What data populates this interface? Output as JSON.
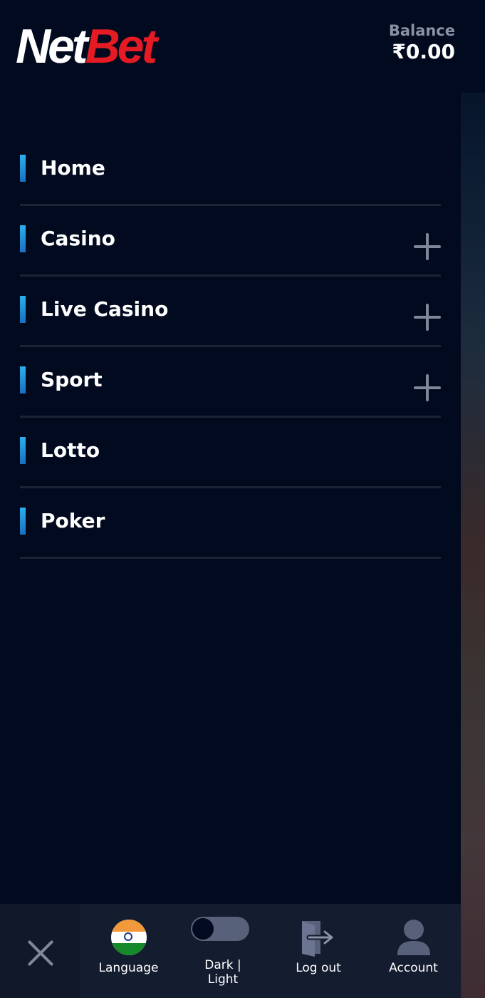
{
  "header": {
    "logo_part1": "Net",
    "logo_part2": "Bet",
    "balance_label": "Balance",
    "balance_amount": "₹0.00"
  },
  "menu": {
    "items": [
      {
        "label": "Home",
        "expandable": false
      },
      {
        "label": "Casino",
        "expandable": true
      },
      {
        "label": "Live Casino",
        "expandable": true
      },
      {
        "label": "Sport",
        "expandable": true
      },
      {
        "label": "Lotto",
        "expandable": false
      },
      {
        "label": "Poker",
        "expandable": false
      }
    ]
  },
  "bottombar": {
    "language_label": "Language",
    "theme_label_line1": "Dark |",
    "theme_label_line2": "Light",
    "logout_label": "Log out",
    "account_label": "Account"
  },
  "colors": {
    "background": "#020a20",
    "brand_red": "#e41b23",
    "accent_blue": "#2bb1ef",
    "muted": "#7f889b"
  },
  "icons": {
    "close": "close-icon",
    "language": "india-flag-icon",
    "theme": "toggle-icon",
    "logout": "logout-icon",
    "account": "user-icon",
    "expand": "plus-icon"
  }
}
